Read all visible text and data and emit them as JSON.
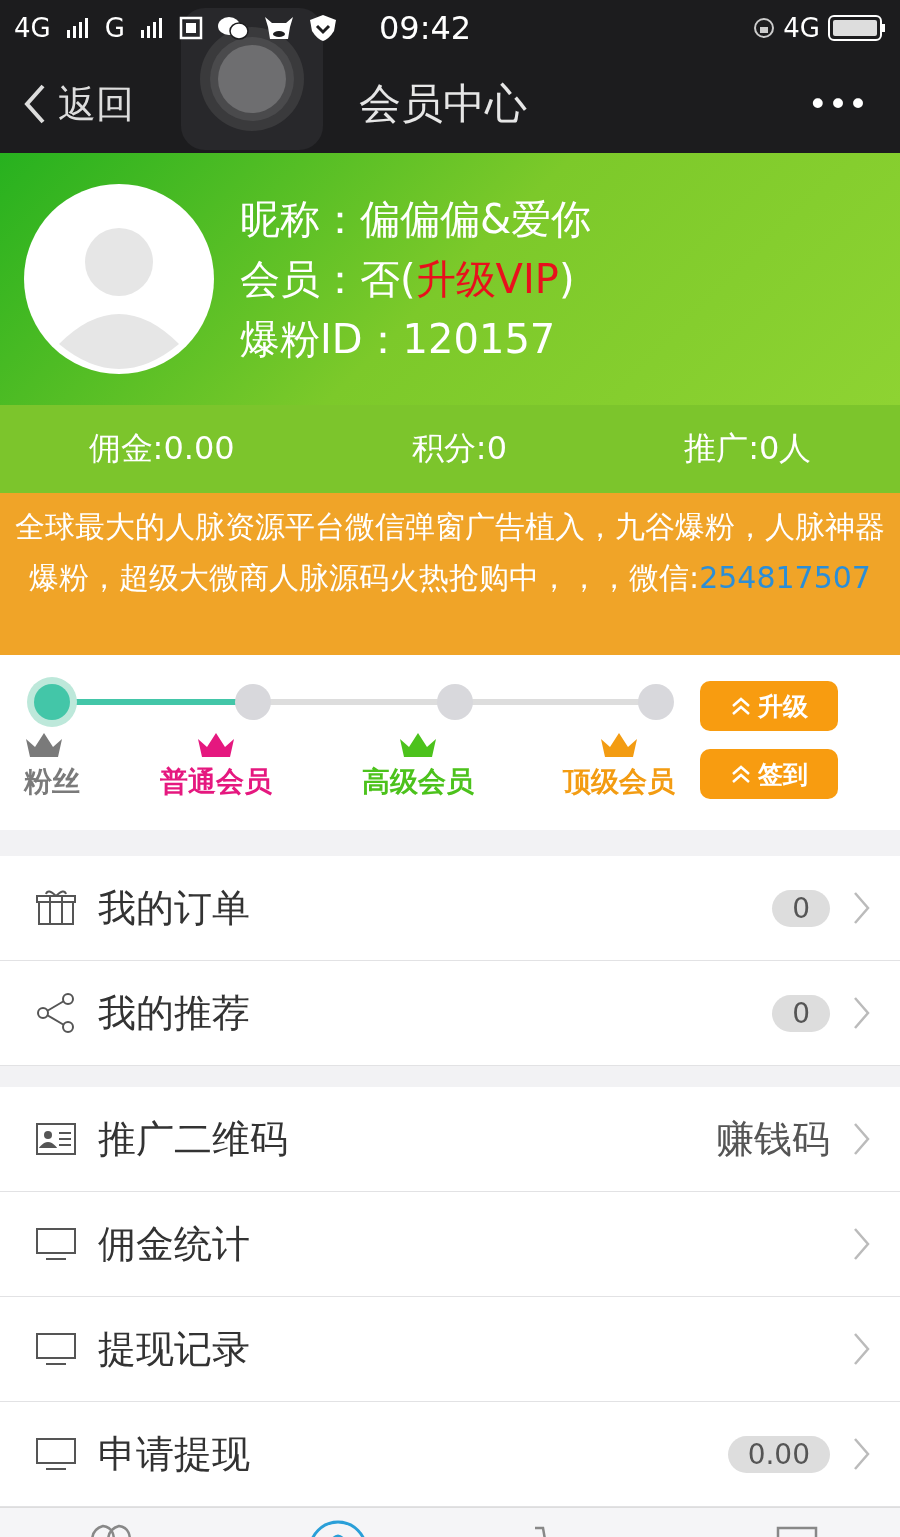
{
  "status_bar": {
    "network_1": "4G",
    "network_2": "G",
    "time": "09:42",
    "network_3": "4G"
  },
  "nav": {
    "back": "返回",
    "title": "会员中心",
    "more": "•••"
  },
  "profile": {
    "fields": [
      {
        "label": "昵称：",
        "value": "偏偏偏&爱你"
      },
      {
        "label": "会员：",
        "value": "否(",
        "link": "升级VIP",
        "suffix": ")"
      },
      {
        "label": "爆粉ID：",
        "value": "120157"
      }
    ]
  },
  "stats": [
    "佣金:0.00",
    "积分:0",
    "推广:0人"
  ],
  "notice": {
    "text": "全球最大的人脉资源平台微信弹窗广告植入，九谷爆粉，人脉神器爆粉，超级大微商人脉源码火热抢购中，，，微信:",
    "contact": "254817507"
  },
  "levels": {
    "progress": {
      "level": 0.333
    },
    "items": [
      {
        "name": "粉丝",
        "color": "#7a7a7a",
        "selected": true
      },
      {
        "name": "普通会员",
        "color": "#e5187f",
        "selected": false
      },
      {
        "name": "高级会员",
        "color": "#4cc21c",
        "selected": false
      },
      {
        "name": "顶级会员",
        "color": "#f39c12",
        "selected": false
      }
    ],
    "buttons": [
      "升级",
      "签到"
    ]
  },
  "menu_groups": [
    [
      {
        "label": "我的订单",
        "kind": "count",
        "value": "0"
      },
      {
        "label": "我的推荐",
        "kind": "count",
        "value": "0"
      }
    ],
    [
      {
        "label": "推广二维码",
        "kind": "text",
        "value": "赚钱码"
      },
      {
        "label": "佣金统计",
        "kind": "none"
      },
      {
        "label": "提现记录",
        "kind": "none"
      },
      {
        "label": "申请提现",
        "kind": "count",
        "value": "0.00"
      }
    ]
  ]
}
